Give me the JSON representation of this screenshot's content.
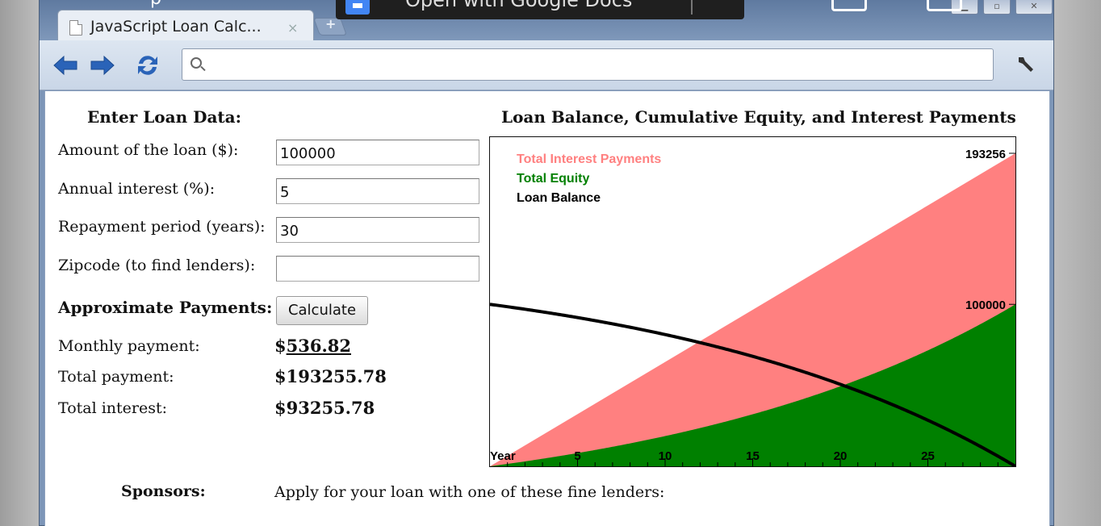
{
  "browser": {
    "tab_title": "JavaScript Loan Calc...",
    "tab_close": "×",
    "newtab_glyph": "+",
    "omnibox_value": "",
    "overlay": {
      "text": "Open with Google Docs",
      "fragment": "p"
    }
  },
  "form": {
    "heading": "Enter Loan Data:",
    "fields": [
      {
        "label": "Amount of the loan ($):",
        "value": "100000"
      },
      {
        "label": "Annual interest (%):",
        "value": "5"
      },
      {
        "label": "Repayment period (years):",
        "value": "30"
      },
      {
        "label": "Zipcode (to find lenders):",
        "value": ""
      }
    ],
    "payments_heading": "Approximate Payments:",
    "calculate_label": "Calculate",
    "results": [
      {
        "label": "Monthly payment:",
        "prefix": "$",
        "value": "536.82"
      },
      {
        "label": "Total payment:",
        "prefix": "",
        "value": "$193255.78"
      },
      {
        "label": "Total interest:",
        "prefix": "",
        "value": "$93255.78"
      }
    ],
    "sponsors_label": "Sponsors:",
    "sponsors_text": "Apply for your loan with one of these fine lenders:"
  },
  "colors": {
    "interest": "#ff8080",
    "equity": "#008000",
    "balance": "#000000"
  },
  "chart_data": {
    "type": "area",
    "title": "Loan Balance, Cumulative Equity, and Interest Payments",
    "xlabel": "Year",
    "x_ticks": [
      "5",
      "10",
      "15",
      "20",
      "25"
    ],
    "x_range": [
      0,
      30
    ],
    "y_range": [
      0,
      193256
    ],
    "y_tick_labels": [
      "193256",
      "100000"
    ],
    "legend": [
      "Total Interest Payments",
      "Total Equity",
      "Loan Balance"
    ],
    "legend_placement": "top-left",
    "loan": {
      "principal": 100000,
      "annual_rate_percent": 5,
      "years": 30,
      "monthly_payment": 536.82
    },
    "series": [
      {
        "name": "Total Interest Payments",
        "x": [
          0,
          5,
          10,
          15,
          20,
          25,
          30
        ],
        "y": [
          0,
          32209,
          64418,
          96628,
          128837,
          161046,
          193256
        ]
      },
      {
        "name": "Total Equity",
        "x": [
          0,
          5,
          10,
          15,
          20,
          25,
          30
        ],
        "y": [
          0,
          8166,
          18628,
          32037,
          49222,
          71245,
          100000
        ]
      },
      {
        "name": "Loan Balance",
        "x": [
          0,
          5,
          10,
          15,
          20,
          25,
          30
        ],
        "y": [
          100000,
          91834,
          81372,
          67963,
          50778,
          28755,
          0
        ]
      }
    ]
  }
}
